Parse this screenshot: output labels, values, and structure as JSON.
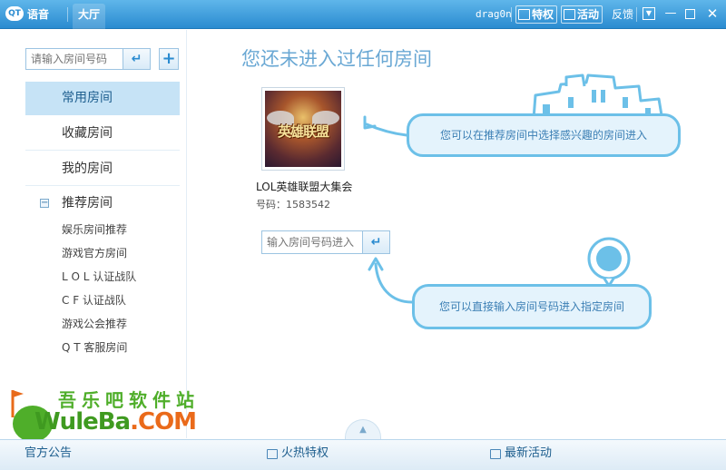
{
  "titlebar": {
    "logo_text": "QT",
    "tab_voice": "语音",
    "tab_hall": "大厅",
    "username": "drag0n",
    "privilege_label": "特权",
    "activity_label": "活动",
    "feedback_label": "反馈"
  },
  "sidebar": {
    "search_placeholder": "请输入房间号码",
    "items": [
      {
        "label": "常用房间"
      },
      {
        "label": "收藏房间"
      },
      {
        "label": "我的房间"
      }
    ],
    "recommend": {
      "label": "推荐房间",
      "toggle": "−",
      "children": [
        {
          "label": "娱乐房间推荐"
        },
        {
          "label": "游戏官方房间"
        },
        {
          "label": "L O L 认证战队"
        },
        {
          "label": "C F 认证战队"
        },
        {
          "label": "游戏公会推荐"
        },
        {
          "label": "Q T 客服房间"
        }
      ]
    }
  },
  "main": {
    "title": "您还未进入过任何房间",
    "room": {
      "name": "LOL英雄联盟大集会",
      "number": "号码：1583542",
      "thumb_text": "英雄联盟"
    },
    "enter_placeholder": "输入房间号码进入",
    "hint_recommend": "您可以在推荐房间中选择感兴趣的房间进入",
    "hint_enter": "您可以直接输入房间号码进入指定房间"
  },
  "watermark": {
    "chinese": "吾乐吧软件站",
    "english_main": "WuleBa",
    "english_suffix": ".COM"
  },
  "bottombar": {
    "announcement": "官方公告",
    "hot_privilege": "火热特权",
    "latest_activity": "最新活动"
  },
  "colors": {
    "titlebar": "#2a8bd0",
    "active_nav": "#c6e3f6",
    "hint_bubble": "#e4f3fc",
    "hint_border": "#6cc0e8",
    "watermark_green": "#4fae2a",
    "watermark_orange": "#ea6a1a"
  }
}
